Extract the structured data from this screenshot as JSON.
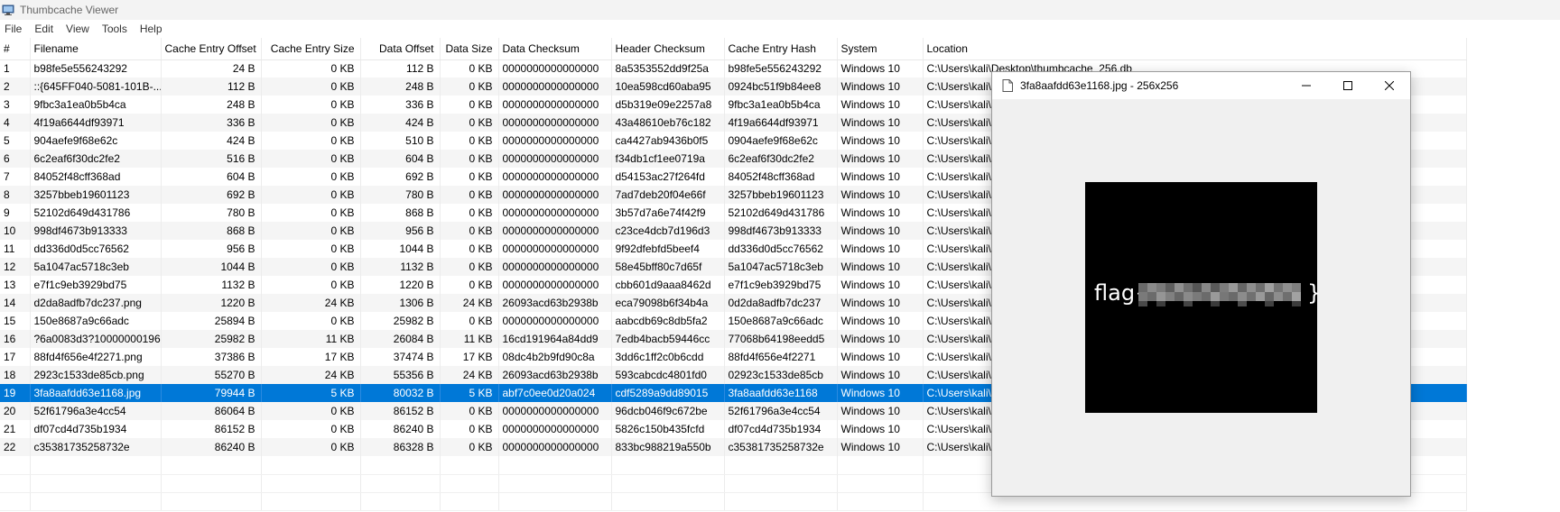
{
  "window": {
    "title": "Thumbcache Viewer"
  },
  "menu": [
    "File",
    "Edit",
    "View",
    "Tools",
    "Help"
  ],
  "columns": [
    "#",
    "Filename",
    "Cache Entry Offset",
    "Cache Entry Size",
    "Data Offset",
    "Data Size",
    "Data Checksum",
    "Header Checksum",
    "Cache Entry Hash",
    "System",
    "Location"
  ],
  "rows": [
    [
      "1",
      "b98fe5e556243292",
      "24 B",
      "0 KB",
      "112 B",
      "0 KB",
      "0000000000000000",
      "8a5353552dd9f25a",
      "b98fe5e556243292",
      "Windows 10",
      "C:\\Users\\kali\\Desktop\\thumbcache_256.db"
    ],
    [
      "2",
      "::{645FF040-5081-101B-...",
      "112 B",
      "0 KB",
      "248 B",
      "0 KB",
      "0000000000000000",
      "10ea598cd60aba95",
      "0924bc51f9b84ee8",
      "Windows 10",
      "C:\\Users\\kali\\"
    ],
    [
      "3",
      "9fbc3a1ea0b5b4ca",
      "248 B",
      "0 KB",
      "336 B",
      "0 KB",
      "0000000000000000",
      "d5b319e09e2257a8",
      "9fbc3a1ea0b5b4ca",
      "Windows 10",
      "C:\\Users\\kali\\"
    ],
    [
      "4",
      "4f19a6644df93971",
      "336 B",
      "0 KB",
      "424 B",
      "0 KB",
      "0000000000000000",
      "43a48610eb76c182",
      "4f19a6644df93971",
      "Windows 10",
      "C:\\Users\\kali\\"
    ],
    [
      "5",
      "904aefe9f68e62c",
      "424 B",
      "0 KB",
      "510 B",
      "0 KB",
      "0000000000000000",
      "ca4427ab9436b0f5",
      "0904aefe9f68e62c",
      "Windows 10",
      "C:\\Users\\kali\\"
    ],
    [
      "6",
      "6c2eaf6f30dc2fe2",
      "516 B",
      "0 KB",
      "604 B",
      "0 KB",
      "0000000000000000",
      "f34db1cf1ee0719a",
      "6c2eaf6f30dc2fe2",
      "Windows 10",
      "C:\\Users\\kali\\"
    ],
    [
      "7",
      "84052f48cff368ad",
      "604 B",
      "0 KB",
      "692 B",
      "0 KB",
      "0000000000000000",
      "d54153ac27f264fd",
      "84052f48cff368ad",
      "Windows 10",
      "C:\\Users\\kali\\"
    ],
    [
      "8",
      "3257bbeb19601123",
      "692 B",
      "0 KB",
      "780 B",
      "0 KB",
      "0000000000000000",
      "7ad7deb20f04e66f",
      "3257bbeb19601123",
      "Windows 10",
      "C:\\Users\\kali\\"
    ],
    [
      "9",
      "52102d649d431786",
      "780 B",
      "0 KB",
      "868 B",
      "0 KB",
      "0000000000000000",
      "3b57d7a6e74f42f9",
      "52102d649d431786",
      "Windows 10",
      "C:\\Users\\kali\\"
    ],
    [
      "10",
      "998df4673b913333",
      "868 B",
      "0 KB",
      "956 B",
      "0 KB",
      "0000000000000000",
      "c23ce4dcb7d196d3",
      "998df4673b913333",
      "Windows 10",
      "C:\\Users\\kali\\"
    ],
    [
      "11",
      "dd336d0d5cc76562",
      "956 B",
      "0 KB",
      "1044 B",
      "0 KB",
      "0000000000000000",
      "9f92dfebfd5beef4",
      "dd336d0d5cc76562",
      "Windows 10",
      "C:\\Users\\kali\\"
    ],
    [
      "12",
      "5a1047ac5718c3eb",
      "1044 B",
      "0 KB",
      "1132 B",
      "0 KB",
      "0000000000000000",
      "58e45bff80c7d65f",
      "5a1047ac5718c3eb",
      "Windows 10",
      "C:\\Users\\kali\\"
    ],
    [
      "13",
      "e7f1c9eb3929bd75",
      "1132 B",
      "0 KB",
      "1220 B",
      "0 KB",
      "0000000000000000",
      "cbb601d9aaa8462d",
      "e7f1c9eb3929bd75",
      "Windows 10",
      "C:\\Users\\kali\\"
    ],
    [
      "14",
      "d2da8adfb7dc237.png",
      "1220 B",
      "24 KB",
      "1306 B",
      "24 KB",
      "26093acd63b2938b",
      "eca79098b6f34b4a",
      "0d2da8adfb7dc237",
      "Windows 10",
      "C:\\Users\\kali\\"
    ],
    [
      "15",
      "150e8687a9c66adc",
      "25894 B",
      "0 KB",
      "25982 B",
      "0 KB",
      "0000000000000000",
      "aabcdb69c8db5fa2",
      "150e8687a9c66adc",
      "Windows 10",
      "C:\\Users\\kali\\"
    ],
    [
      "16",
      "?6a0083d3?10000000196...",
      "25982 B",
      "11 KB",
      "26084 B",
      "11 KB",
      "16cd191964a84dd9",
      "7edb4bacb59446cc",
      "77068b64198eedd5",
      "Windows 10",
      "C:\\Users\\kali\\"
    ],
    [
      "17",
      "88fd4f656e4f2271.png",
      "37386 B",
      "17 KB",
      "37474 B",
      "17 KB",
      "08dc4b2b9fd90c8a",
      "3dd6c1ff2c0b6cdd",
      "88fd4f656e4f2271",
      "Windows 10",
      "C:\\Users\\kali\\"
    ],
    [
      "18",
      "2923c1533de85cb.png",
      "55270 B",
      "24 KB",
      "55356 B",
      "24 KB",
      "26093acd63b2938b",
      "593cabcdc4801fd0",
      "02923c1533de85cb",
      "Windows 10",
      "C:\\Users\\kali\\"
    ],
    [
      "19",
      "3fa8aafdd63e1168.jpg",
      "79944 B",
      "5 KB",
      "80032 B",
      "5 KB",
      "abf7c0ee0d20a024",
      "cdf5289a9dd89015",
      "3fa8aafdd63e1168",
      "Windows 10",
      "C:\\Users\\kali\\"
    ],
    [
      "20",
      "52f61796a3e4cc54",
      "86064 B",
      "0 KB",
      "86152 B",
      "0 KB",
      "0000000000000000",
      "96dcb046f9c672be",
      "52f61796a3e4cc54",
      "Windows 10",
      "C:\\Users\\kali\\"
    ],
    [
      "21",
      "df07cd4d735b1934",
      "86152 B",
      "0 KB",
      "86240 B",
      "0 KB",
      "0000000000000000",
      "5826c150b435fcfd",
      "df07cd4d735b1934",
      "Windows 10",
      "C:\\Users\\kali\\"
    ],
    [
      "22",
      "c35381735258732e",
      "86240 B",
      "0 KB",
      "86328 B",
      "0 KB",
      "0000000000000000",
      "833bc988219a550b",
      "c35381735258732e",
      "Windows 10",
      "C:\\Users\\kali\\"
    ]
  ],
  "selected_row": 19,
  "viewer": {
    "title": "3fa8aafdd63e1168.jpg - 256x256",
    "flag_prefix": "flag{",
    "flag_suffix": "}"
  },
  "colors": {
    "selection": "#0078d7",
    "thumb_bg": "#000000"
  },
  "icons": [
    "app-icon",
    "document-icon",
    "minimize-icon",
    "maximize-icon",
    "close-icon"
  ]
}
